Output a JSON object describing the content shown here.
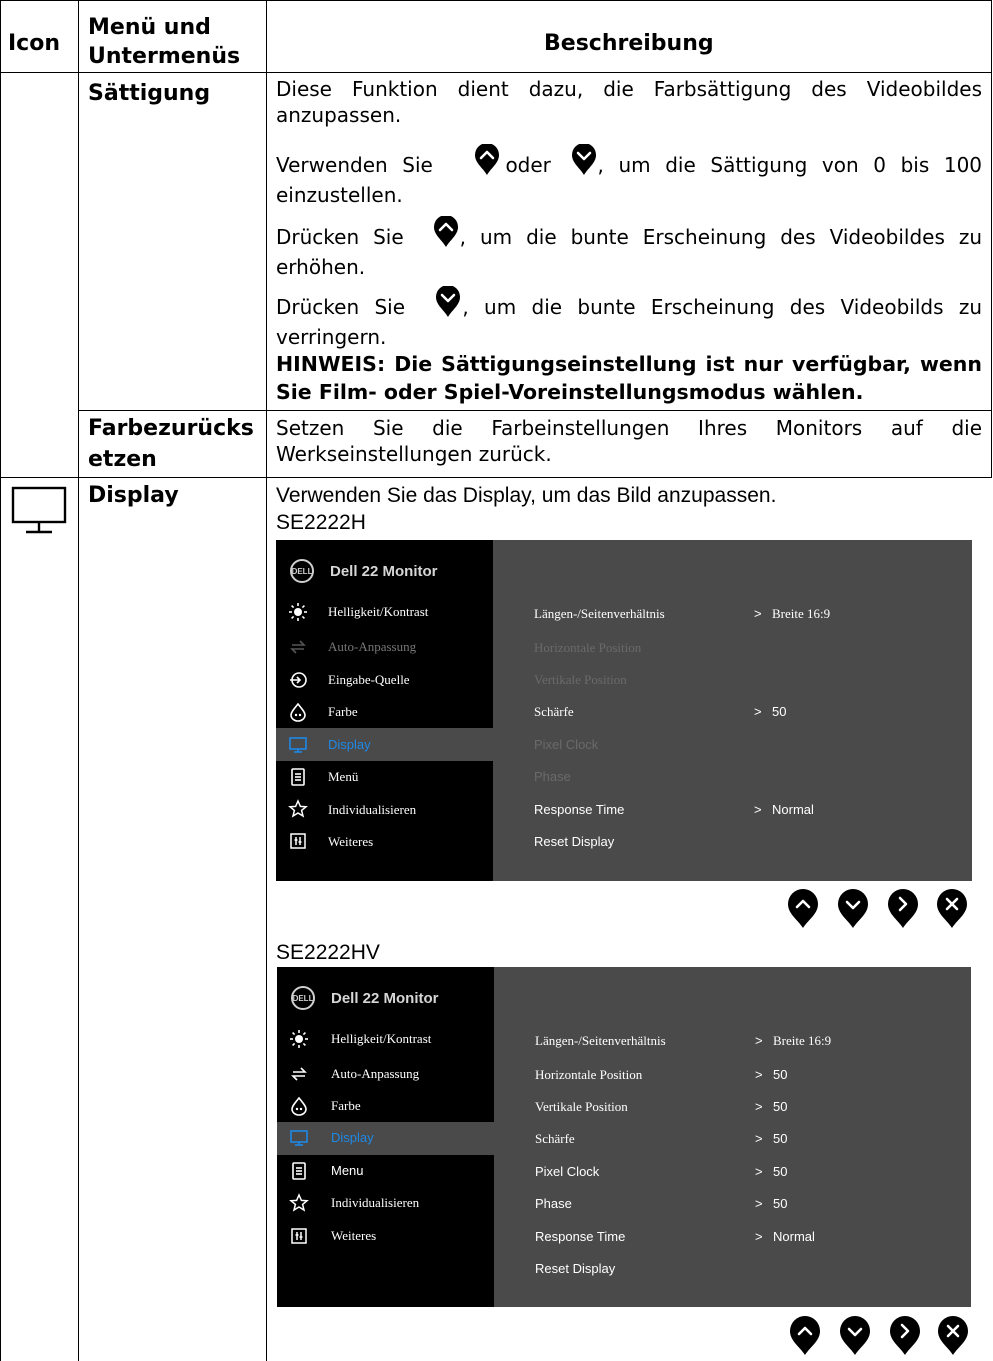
{
  "table": {
    "header": {
      "icon": "Icon",
      "menu_line1": "Menü und",
      "menu_line2": "Untermenüs",
      "description": "Beschreibung"
    },
    "rows": [
      {
        "menu": "Sättigung",
        "p1": "Diese Funktion dient dazu, die Farbsättigung des Videobildes anzupassen.",
        "p2_a": "Verwenden Sie",
        "p2_b": "oder",
        "p2_c": ", um die Sättigung von 0 bis 100 einzustellen.",
        "p3_a": "Drücken Sie",
        "p3_b": ", um die bunte Erscheinung des Videobildes zu erhöhen.",
        "p4_a": "Drücken Sie",
        "p4_b": ", um die bunte Erscheinung des Videobilds zu verringern.",
        "note": "HINWEIS: Die Sättigungseinstellung ist nur verfügbar, wenn Sie Film- oder Spiel-Voreinstellungsmodus wählen."
      },
      {
        "menu_line1": "Farbezurücks",
        "menu_line2": "etzen",
        "desc": "Setzen Sie die Farbeinstellungen Ihres Monitors auf die Werkseinstellungen zurück."
      },
      {
        "icon": "monitor-icon",
        "menu": "Display",
        "intro": "Verwenden Sie das Display, um das Bild anzupassen.",
        "model1": "SE2222H",
        "model2": "SE2222HV"
      }
    ]
  },
  "osd1": {
    "title": "Dell 22 Monitor",
    "brand": "DELL",
    "menu": [
      "Helligkeit/Kontrast",
      "Auto-Anpassung",
      "Eingabe-Quelle",
      "Farbe",
      "Display",
      "Menü",
      "Individualisieren",
      "Weiteres"
    ],
    "items": [
      "Längen-/Seitenverhältnis",
      "Horizontale Position",
      "Vertikale Position",
      "Schärfe",
      "Pixel Clock",
      "Phase",
      "Response Time",
      "Reset Display"
    ],
    "values": [
      "Breite 16:9",
      "",
      "",
      "50",
      "",
      "",
      "Normal",
      ""
    ]
  },
  "osd2": {
    "title": "Dell 22 Monitor",
    "brand": "DELL",
    "menu": [
      "Helligkeit/Kontrast",
      "Auto-Anpassung",
      "Farbe",
      "Display",
      "Menu",
      "Individualisieren",
      "Weiteres"
    ],
    "items": [
      "Längen-/Seitenverhältnis",
      "Horizontale Position",
      "Vertikale Position",
      "Schärfe",
      "Pixel Clock",
      "Phase",
      "Response Time",
      "Reset Display"
    ],
    "values": [
      "Breite 16:9",
      "50",
      "50",
      "50",
      "50",
      "50",
      "Normal",
      ""
    ]
  },
  "value_arrow": ">",
  "nav_buttons": [
    "up-button",
    "down-button",
    "right-button",
    "close-button"
  ],
  "colors": {
    "osd_bg": "#4a4a4a",
    "osd_left": "#000000",
    "highlight": "#1e88e5",
    "button": "#000000"
  }
}
